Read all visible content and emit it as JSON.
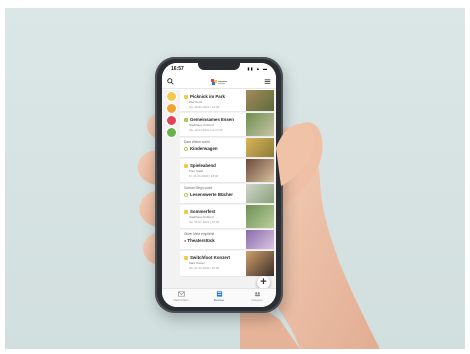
{
  "status": {
    "time": "16:57",
    "icons": "▮▮ ▲ ▬"
  },
  "feed": [
    {
      "title": "Picknick im Park",
      "sub": "Wer Kurst",
      "date": "Sa, 29.01.2022 | 14:00",
      "bullet": "#f2c94c",
      "thumb": [
        "#a38a5a",
        "#5f6b3c"
      ]
    },
    {
      "title": "Gemeinsames Essen",
      "sub": "Stadthaus Koblenz",
      "date": "Sa, 19.04.2021 um 17:00",
      "bullet": "#a9cc5a",
      "thumb": [
        "#6d8f4e",
        "#c9c4a8"
      ]
    },
    {
      "author": "Dara Weber sucht",
      "title": "Kinderwagen",
      "thumb": [
        "#d9b457",
        "#8c7c3a"
      ]
    },
    {
      "title": "Spieleabend",
      "sub": "Zoro Stadt",
      "date": "Fr, 01.06.2020 | 18:00",
      "bullet": "#f2c94c",
      "thumb": [
        "#6b4a3a",
        "#d8c3a0"
      ]
    },
    {
      "author": "Gorhan Singh sucht",
      "title": "Lesenswerte Bücher",
      "thumb": [
        "#cfd6c8",
        "#8aa07a"
      ]
    },
    {
      "title": "Sommerfest",
      "sub": "Stadthaus Koblenz",
      "date": "Sa, 06.07.2021 | 16:00",
      "bullet": "#f2c94c",
      "thumb": [
        "#6f8f57",
        "#b9cf9a"
      ]
    },
    {
      "author": "Oliver Metz empfiehlt",
      "title": "Theaterstück",
      "thumb": [
        "#8a6aa8",
        "#d9c6e6"
      ]
    },
    {
      "title": "Switchfoot Konzert",
      "sub": "Maxi Weber",
      "date": "Sa, 21.01.2022 | 20:00",
      "bullet": "#f2c94c",
      "thumb": [
        "#d0a06a",
        "#3b2f2a"
      ]
    }
  ],
  "side_circles": [
    "#f2c94c",
    "#f0a230",
    "#e04058",
    "#6ab04c"
  ],
  "tabs": [
    {
      "label": "Nachrichten",
      "icon": "envelope-icon"
    },
    {
      "label": "Beiträge",
      "icon": "feed-icon",
      "active": true
    },
    {
      "label": "Gruppen",
      "icon": "group-icon"
    }
  ],
  "colors": {
    "accent": "#2e79c9",
    "background": "#d6e2e2"
  }
}
